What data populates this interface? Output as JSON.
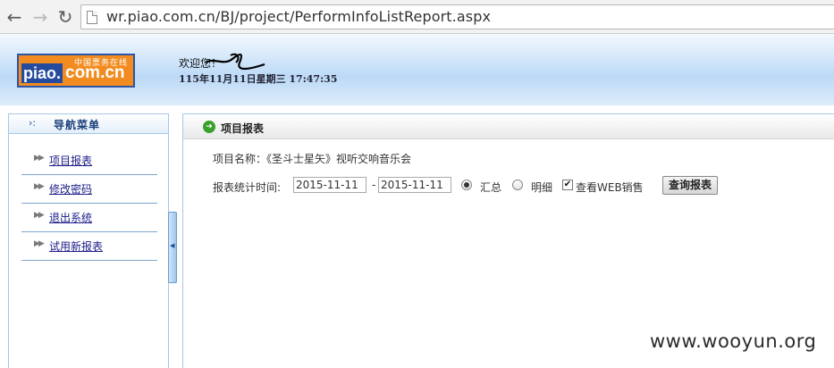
{
  "browser": {
    "back_icon": "←",
    "forward_icon": "→",
    "reload_icon": "↻",
    "url": "wr.piao.com.cn/BJ/project/PerformInfoListReport.aspx"
  },
  "header": {
    "logo_top": "中国票务在线",
    "logo_piao": "piao.",
    "logo_com": "com.cn",
    "welcome": "欢迎您！",
    "datetime": "115年11月11日星期三 17:47:35"
  },
  "sidebar": {
    "title": "导航菜单",
    "title_marker": "›:",
    "items": [
      {
        "label": "项目报表"
      },
      {
        "label": "修改密码"
      },
      {
        "label": "退出系统"
      },
      {
        "label": "试用新报表"
      }
    ],
    "item_arrow": "▶▶",
    "collapse_icon": "◀"
  },
  "main": {
    "title": "项目报表",
    "project_label": "项目名称：",
    "project_name": "《圣斗士星矢》视听交响音乐会",
    "report_time_label": "报表统计时间:",
    "date_from": "2015-11-11",
    "date_separator": "-",
    "date_to": "2015-11-11",
    "opt_summary": "汇总",
    "opt_detail": "明细",
    "opt_web": "查看WEB销售",
    "query_button": "查询报表"
  },
  "watermark": "www.wooyun.org",
  "colors": {
    "header_gradient": "#bcd9f6",
    "logo_orange": "#f28c20",
    "logo_blue": "#254b9e",
    "border_blue": "#a7c7e7",
    "link": "#1c1c8a"
  }
}
